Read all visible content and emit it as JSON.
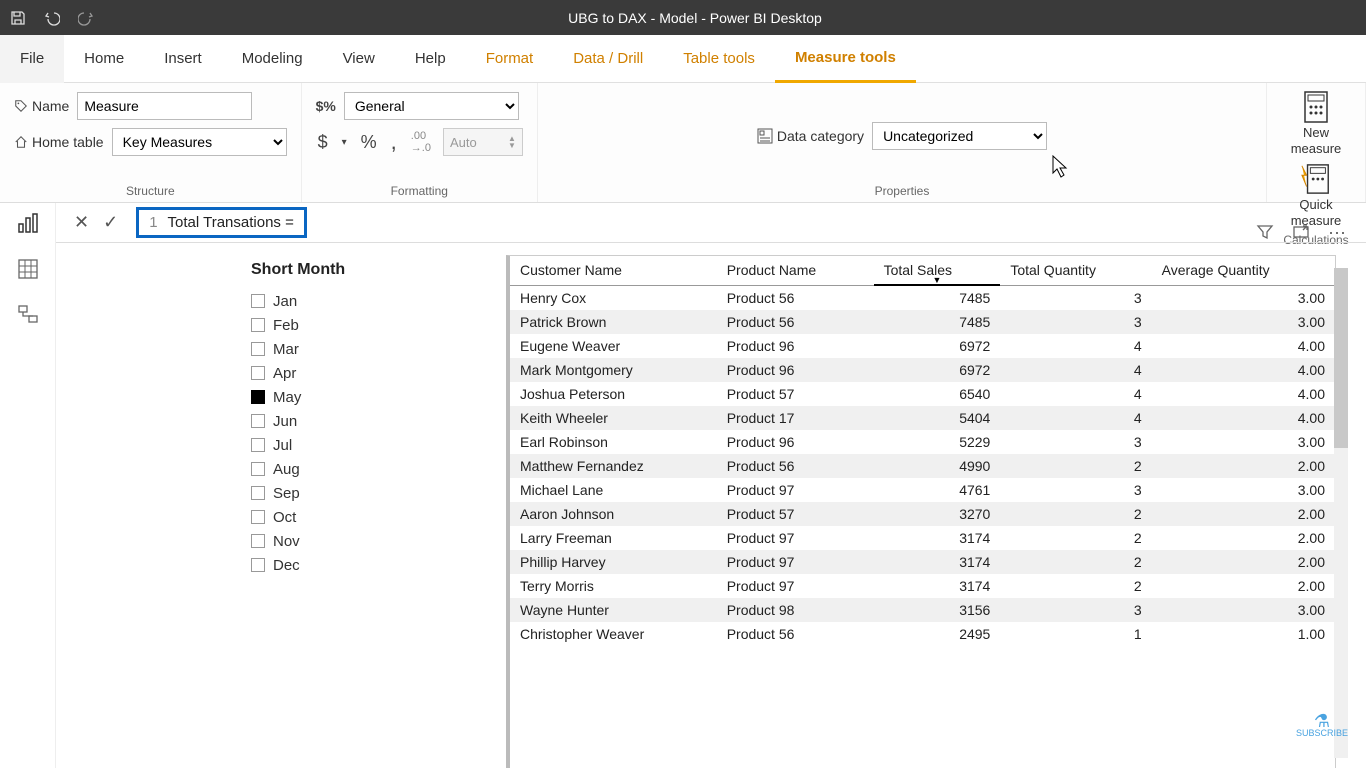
{
  "titlebar": {
    "title": "UBG to DAX - Model - Power BI Desktop"
  },
  "menu": {
    "file": "File",
    "items": [
      "Home",
      "Insert",
      "Modeling",
      "View",
      "Help"
    ],
    "context": [
      "Format",
      "Data / Drill",
      "Table tools",
      "Measure tools"
    ],
    "active": "Measure tools"
  },
  "ribbon": {
    "structure": {
      "name_label": "Name",
      "name_value": "Measure",
      "home_table_label": "Home table",
      "home_table_value": "Key Measures",
      "group_label": "Structure"
    },
    "formatting": {
      "format_value": "General",
      "auto_label": "Auto",
      "currency": "$",
      "percent": "%",
      "comma": ",",
      "decimal_icon": ".00→.0",
      "group_label": "Formatting"
    },
    "properties": {
      "data_category_label": "Data category",
      "data_category_value": "Uncategorized",
      "group_label": "Properties"
    },
    "calculations": {
      "new_measure": "New measure",
      "quick_measure": "Quick measure",
      "group_label": "Calculations"
    }
  },
  "formula": {
    "line": "1",
    "code": "Total Transations ="
  },
  "slicer": {
    "title": "Short Month",
    "items": [
      {
        "label": "Jan",
        "checked": false
      },
      {
        "label": "Feb",
        "checked": false
      },
      {
        "label": "Mar",
        "checked": false
      },
      {
        "label": "Apr",
        "checked": false
      },
      {
        "label": "May",
        "checked": true
      },
      {
        "label": "Jun",
        "checked": false
      },
      {
        "label": "Jul",
        "checked": false
      },
      {
        "label": "Aug",
        "checked": false
      },
      {
        "label": "Sep",
        "checked": false
      },
      {
        "label": "Oct",
        "checked": false
      },
      {
        "label": "Nov",
        "checked": false
      },
      {
        "label": "Dec",
        "checked": false
      }
    ]
  },
  "table": {
    "columns": [
      "Customer Name",
      "Product Name",
      "Total Sales",
      "Total Quantity",
      "Average Quantity"
    ],
    "sort_col": 2,
    "rows": [
      [
        "Henry Cox",
        "Product 56",
        "7485",
        "3",
        "3.00"
      ],
      [
        "Patrick Brown",
        "Product 56",
        "7485",
        "3",
        "3.00"
      ],
      [
        "Eugene Weaver",
        "Product 96",
        "6972",
        "4",
        "4.00"
      ],
      [
        "Mark Montgomery",
        "Product 96",
        "6972",
        "4",
        "4.00"
      ],
      [
        "Joshua Peterson",
        "Product 57",
        "6540",
        "4",
        "4.00"
      ],
      [
        "Keith Wheeler",
        "Product 17",
        "5404",
        "4",
        "4.00"
      ],
      [
        "Earl Robinson",
        "Product 96",
        "5229",
        "3",
        "3.00"
      ],
      [
        "Matthew Fernandez",
        "Product 56",
        "4990",
        "2",
        "2.00"
      ],
      [
        "Michael Lane",
        "Product 97",
        "4761",
        "3",
        "3.00"
      ],
      [
        "Aaron Johnson",
        "Product 57",
        "3270",
        "2",
        "2.00"
      ],
      [
        "Larry Freeman",
        "Product 97",
        "3174",
        "2",
        "2.00"
      ],
      [
        "Phillip Harvey",
        "Product 97",
        "3174",
        "2",
        "2.00"
      ],
      [
        "Terry Morris",
        "Product 97",
        "3174",
        "2",
        "2.00"
      ],
      [
        "Wayne Hunter",
        "Product 98",
        "3156",
        "3",
        "3.00"
      ],
      [
        "Christopher Weaver",
        "Product 56",
        "2495",
        "1",
        "1.00"
      ]
    ]
  },
  "subscribe": "SUBSCRIBE"
}
